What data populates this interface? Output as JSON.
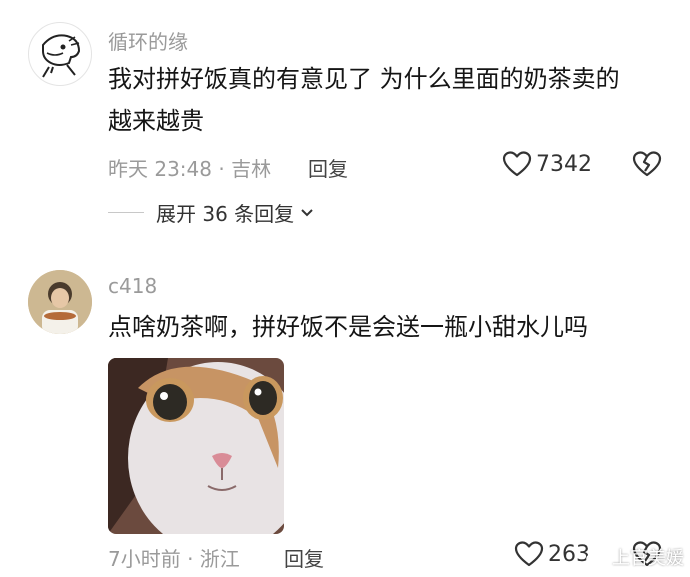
{
  "comments": [
    {
      "username": "循环的缘",
      "text": "我对拼好饭真的有意见了 为什么里面的奶茶卖的\n越来越贵",
      "meta": "昨天 23:48 · 吉林",
      "reply_label": "回复",
      "likes": "7342",
      "expand_label": "展开 36 条回复"
    },
    {
      "username": "c418",
      "text": "点啥奶茶啊，拼好饭不是会送一瓶小甜水儿吗",
      "meta": "7小时前 · 浙江",
      "reply_label": "回复",
      "likes": "263"
    }
  ],
  "watermark": {
    "text": "上官美媛",
    "icon": "weibo-logo"
  },
  "icons": [
    "heart-icon",
    "broken-heart-icon",
    "chevron-down-icon"
  ]
}
